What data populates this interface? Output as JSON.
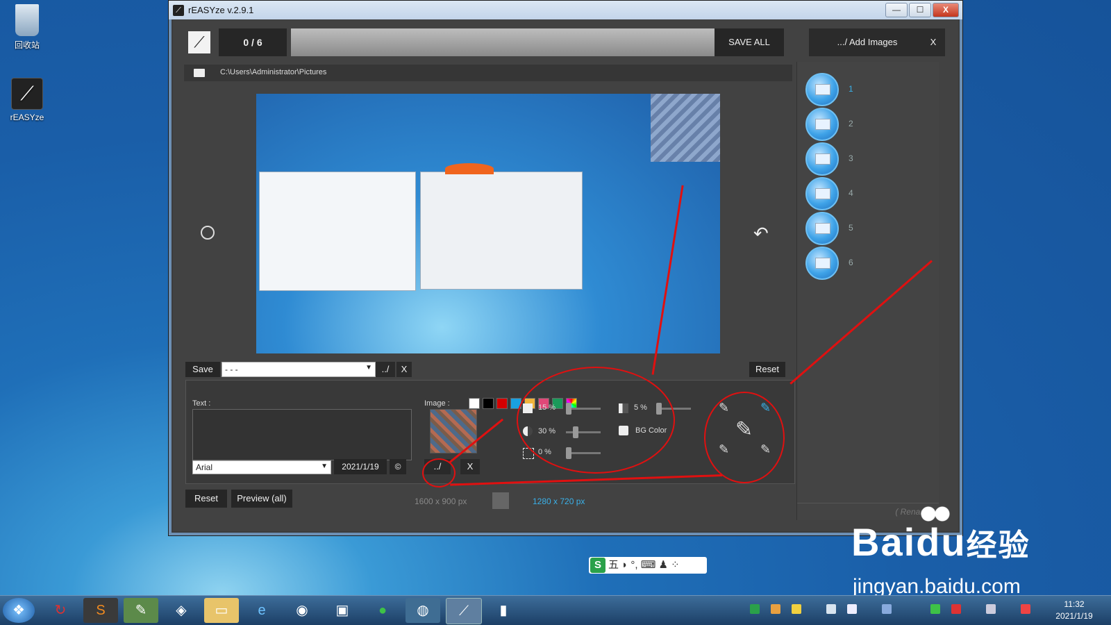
{
  "desktop": {
    "recycle_label": "回收站",
    "app_label": "rEASYze"
  },
  "window": {
    "title": "rEASYze v.2.9.1",
    "minimize": "—",
    "maximize": "☐",
    "close": "X"
  },
  "toolbar": {
    "counter": "0 / 6",
    "save_all": "SAVE ALL",
    "add_images": ".../ Add Images",
    "close": "X"
  },
  "path": {
    "value": "C:\\Users\\Administrator\\Pictures"
  },
  "preset": {
    "save": "Save",
    "selected": "- - -",
    "browse": "../",
    "clear": "X",
    "reset": "Reset"
  },
  "text_panel": {
    "label": "Text :",
    "font": "Arial",
    "date": "2021/1/19",
    "copyright": "©",
    "colors": [
      "#ffffff",
      "#000000",
      "#d40000",
      "#1aa0e0",
      "#f0b43c",
      "#e04878",
      "#1a9a5a"
    ]
  },
  "image_panel": {
    "label": "Image :",
    "browse": "../",
    "clear": "X"
  },
  "adjust": {
    "size": "15 %",
    "size_level": 15,
    "opacity": "30 %",
    "opacity_level": 30,
    "margin": "0 %",
    "margin_level": 0,
    "border": "5 %",
    "border_level": 5,
    "bg_color": "BG Color"
  },
  "bottom": {
    "reset": "Reset",
    "preview": "Preview (all)",
    "source_size": "1600 x 900 px",
    "target_size": "1280 x 720 px"
  },
  "thumbs": [
    "1",
    "2",
    "3",
    "4",
    "5",
    "6"
  ],
  "rename": "( Rename",
  "watermark": {
    "brand": "Bai",
    "brand2": "du",
    "brand3": "经验",
    "url": "jingyan.baidu.com"
  },
  "ime": {
    "text": "五 ◗ °, ⌨ ♟ ⁘"
  },
  "clock": {
    "time": "11:32",
    "date": "2021/1/19"
  },
  "colors": {
    "accent": "#3ab0e8",
    "annotation": "#e01010"
  }
}
